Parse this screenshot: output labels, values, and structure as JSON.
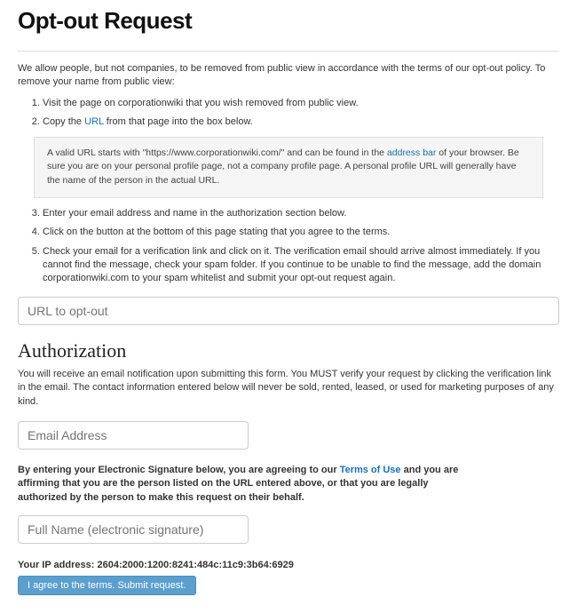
{
  "title": "Opt-out Request",
  "intro": "We allow people, but not companies, to be removed from public view in accordance with the terms of our opt-out policy. To remove your name from public view:",
  "steps": {
    "s1": "Visit the page on corporationwiki that you wish removed from public view.",
    "s2a": "Copy the ",
    "s2_link": "URL",
    "s2b": " from that page into the box below.",
    "s3": "Enter your email address and name in the authorization section below.",
    "s4": "Click on the button at the bottom of this page stating that you agree to the terms.",
    "s5": "Check your email for a verification link and click on it. The verification email should arrive almost immediately. If you cannot find the message, check your spam folder. If you continue to be unable to find the message, add the domain corporationwiki.com to your spam whitelist and submit your opt-out request again."
  },
  "note": {
    "a": "A valid URL starts with \"https://www.corporationwiki.com/\" and can be found in the ",
    "link": "address bar",
    "b": " of your browser. Be sure you are on your personal profile page, not a company profile page. A personal profile URL will generally have the name of the person in the actual URL."
  },
  "url_placeholder": "URL to opt-out",
  "auth": {
    "heading": "Authorization",
    "text": "You will receive an email notification upon submitting this form. You MUST verify your request by clicking the verification link in the email. The contact information entered below will never be sold, rented, leased, or used for marketing purposes of any kind.",
    "email_placeholder": "Email Address"
  },
  "sig": {
    "a": "By entering your Electronic Signature below, you are agreeing to our ",
    "link": "Terms of Use",
    "b": " and you are affirming that you are the person listed on the URL entered above, or that you are legally authorized by the person to make this request on their behalf.",
    "placeholder": "Full Name (electronic signature)"
  },
  "ip": {
    "label": "Your IP address: ",
    "value": "2604:2000:1200:8241:484c:11c9:3b64:6929"
  },
  "submit_label": "I agree to the terms. Submit request."
}
